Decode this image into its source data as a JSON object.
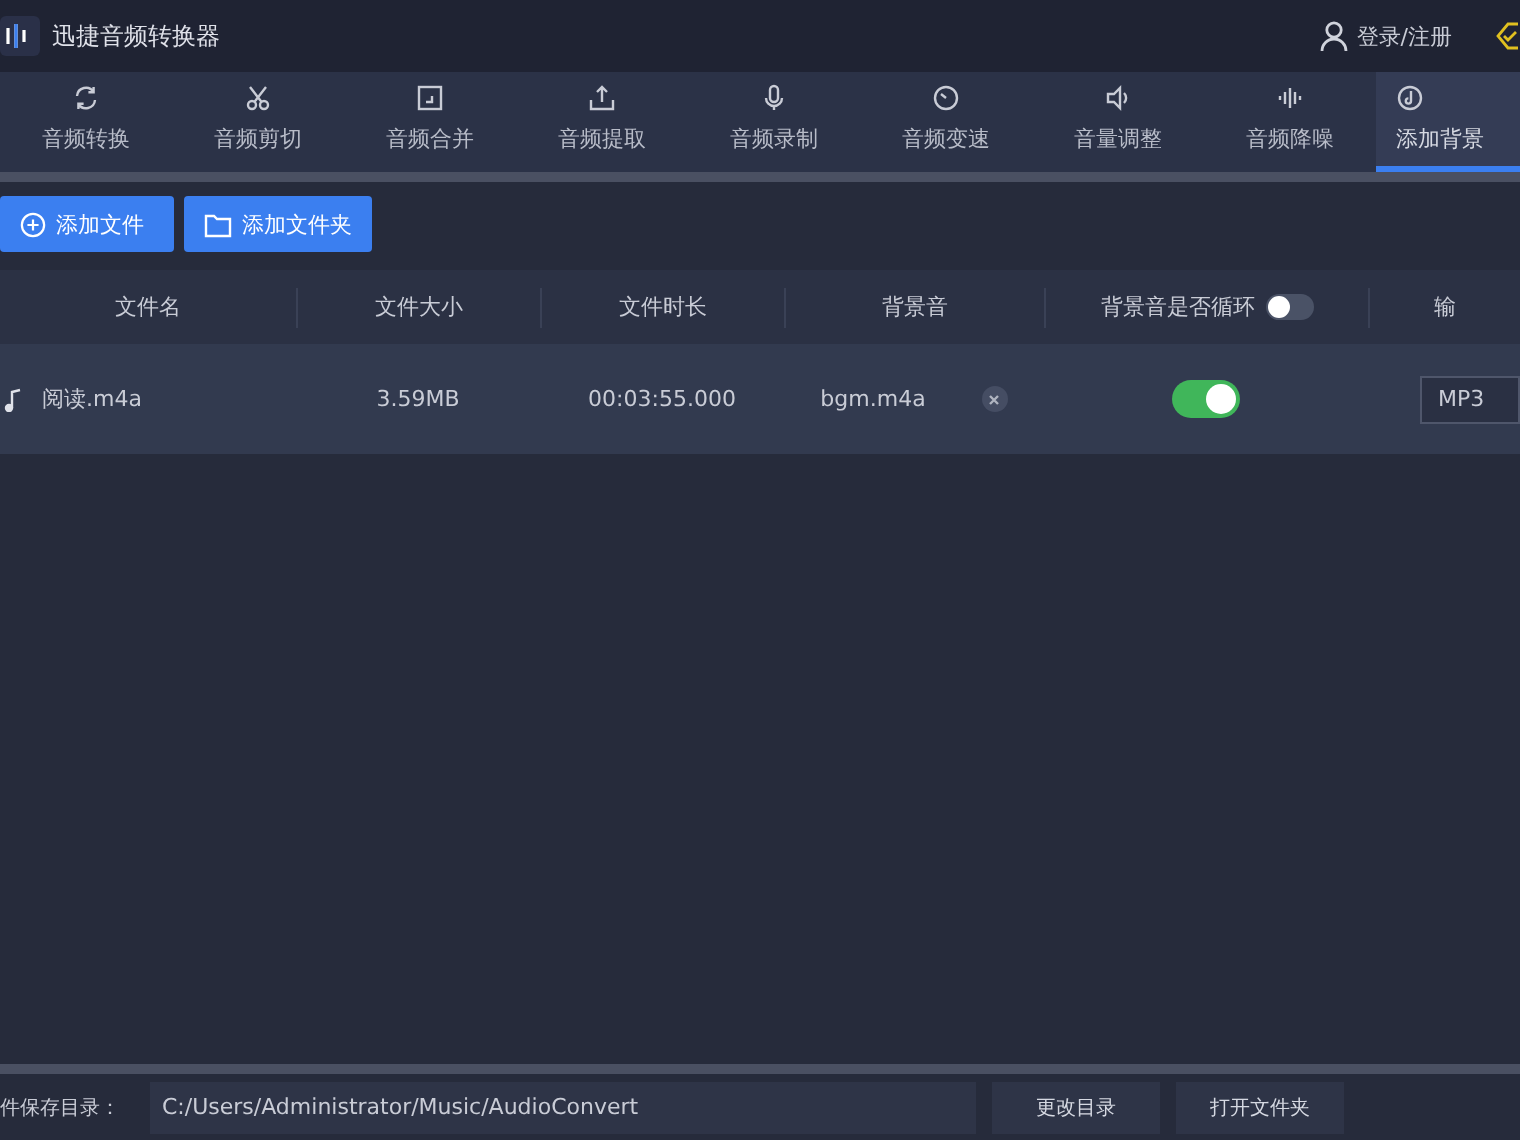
{
  "app": {
    "title": "迅捷音频转换器",
    "login": "登录/注册"
  },
  "tabs": [
    {
      "label": "音频转换",
      "selected": false
    },
    {
      "label": "音频剪切",
      "selected": false
    },
    {
      "label": "音频合并",
      "selected": false
    },
    {
      "label": "音频提取",
      "selected": false
    },
    {
      "label": "音频录制",
      "selected": false
    },
    {
      "label": "音频变速",
      "selected": false
    },
    {
      "label": "音量调整",
      "selected": false
    },
    {
      "label": "音频降噪",
      "selected": false
    },
    {
      "label": "添加背景",
      "selected": true
    }
  ],
  "toolbar": [
    "添加文件",
    "添加文件夹"
  ],
  "table": {
    "columns": [
      "文件名",
      "文件大小",
      "文件时长",
      "背景音",
      "背景音是否循环",
      "输"
    ],
    "loop_all_on": false,
    "rows": [
      {
        "name": "阅读.m4a",
        "size": "3.59MB",
        "duration": "00:03:55.000",
        "bgm": "bgm.m4a",
        "loop_on": true,
        "format": "MP3"
      }
    ]
  },
  "footer": {
    "label": "件保存目录：",
    "path": "C:/Users/Administrator/Music/AudioConvert",
    "buttons": [
      "更改目录",
      "打开文件夹"
    ]
  }
}
